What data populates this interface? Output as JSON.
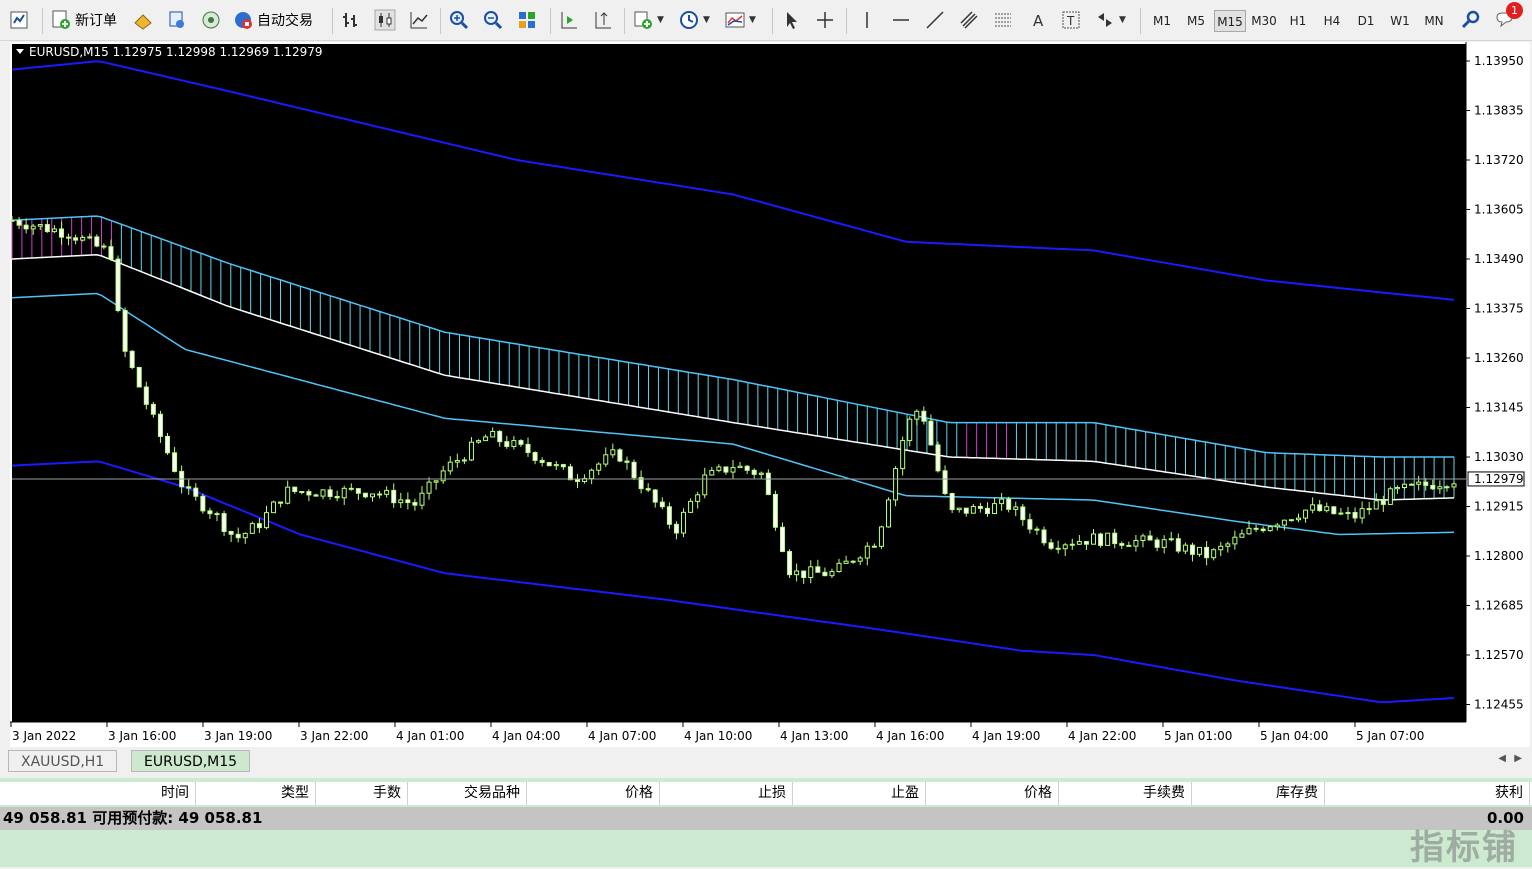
{
  "toolbar": {
    "new_order_label": "新订单",
    "auto_trade_label": "自动交易",
    "timeframes": [
      "M1",
      "M5",
      "M15",
      "M30",
      "H1",
      "H4",
      "D1",
      "W1",
      "MN"
    ],
    "active_timeframe": "M15",
    "notification_count": "1"
  },
  "chart": {
    "header": "EURUSD,M15  1.12975 1.12998 1.12969 1.12979",
    "current_price": "1.12979",
    "price_labels": [
      "1.13950",
      "1.13835",
      "1.13720",
      "1.13605",
      "1.13490",
      "1.13375",
      "1.13260",
      "1.13145",
      "1.13030",
      "1.12915",
      "1.12800",
      "1.12685",
      "1.12570",
      "1.12455"
    ],
    "time_labels": [
      "3 Jan 2022",
      "3 Jan 16:00",
      "3 Jan 19:00",
      "3 Jan 22:00",
      "4 Jan 01:00",
      "4 Jan 04:00",
      "4 Jan 07:00",
      "4 Jan 10:00",
      "4 Jan 13:00",
      "4 Jan 16:00",
      "4 Jan 19:00",
      "4 Jan 22:00",
      "5 Jan 01:00",
      "5 Jan 04:00",
      "5 Jan 07:00"
    ],
    "colors": {
      "background": "#000000",
      "candle_up": "#b8ff7a",
      "candle_down": "#ffffff",
      "band_outer": "#1a1aff",
      "band_mid": "#4fc3f7",
      "band_center": "#ffffff",
      "fill_up": "#5fd8f0",
      "fill_down": "#d040d0"
    }
  },
  "tabs": [
    {
      "label": "XAUUSD,H1",
      "active": false
    },
    {
      "label": "EURUSD,M15",
      "active": true
    }
  ],
  "terminal": {
    "columns": [
      "时间",
      "类型",
      "手数",
      "交易品种",
      "价格",
      "止损",
      "止盈",
      "价格",
      "手续费",
      "库存费",
      "获利"
    ],
    "balance_text": "49 058.81  可用预付款: 49 058.81",
    "profit_total": "0.00"
  },
  "watermark": "指标铺"
}
